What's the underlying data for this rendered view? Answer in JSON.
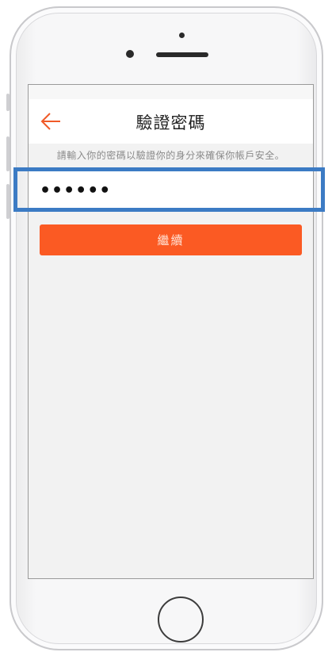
{
  "header": {
    "back_icon": "arrow-left-icon",
    "title": "驗證密碼"
  },
  "hint_text": "請輸入你的密碼以驗證你的身分來確保你帳戶安全。",
  "password": {
    "value": "••••••",
    "type": "password"
  },
  "continue_button": {
    "label": "繼續"
  },
  "colors": {
    "accent": "#fb5a23",
    "back_arrow": "#f05a28",
    "highlight": "#3c7bc4"
  }
}
